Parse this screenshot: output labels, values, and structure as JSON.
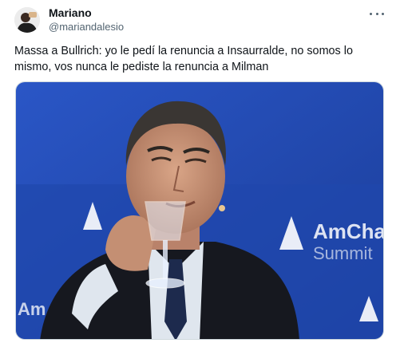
{
  "author": {
    "display_name": "Mariano",
    "handle": "@mariandalesio"
  },
  "tweet": {
    "text_line1": "Massa a Bullrich: yo le pedí la renuncia a Insaurralde, no somos lo",
    "text_line2": "mismo, vos nunca le pediste la renuncia a Milman"
  },
  "media": {
    "backdrop_logo_text_1": "AmCham",
    "backdrop_logo_text_2": "Summit",
    "backdrop_logo_text_left": "Am"
  },
  "icons": {
    "more": "more-horizontal-icon"
  },
  "colors": {
    "backdrop_blue": "#2346a6",
    "text_primary": "#0f1419",
    "text_secondary": "#536471"
  }
}
